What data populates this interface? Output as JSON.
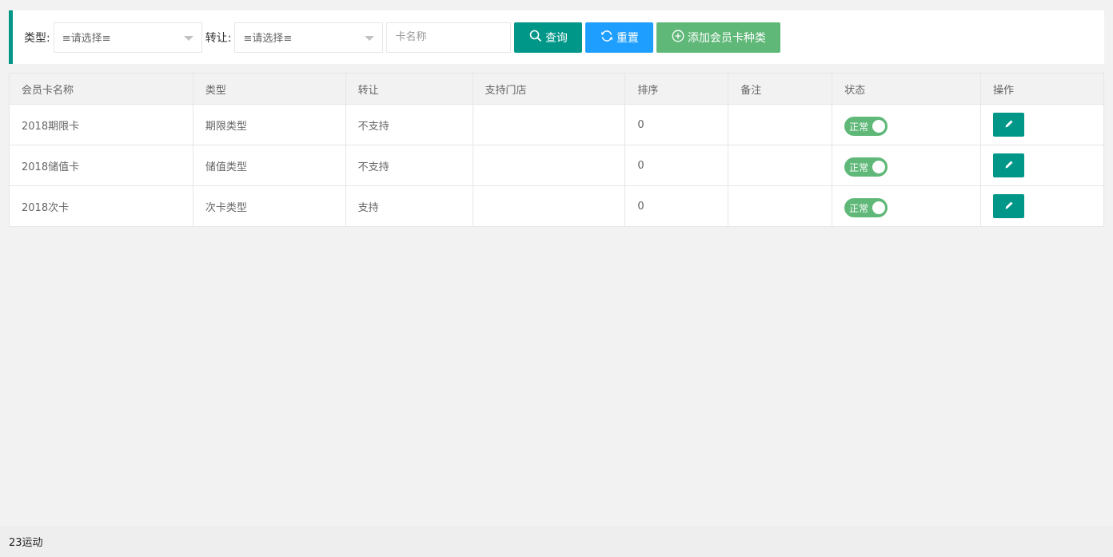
{
  "filters": {
    "type_label": "类型:",
    "type_value": "≡请选择≡",
    "transfer_label": "转让:",
    "transfer_value": "≡请选择≡",
    "name_placeholder": "卡名称",
    "query_label": "查询",
    "reset_label": "重置",
    "add_label": "添加会员卡种类"
  },
  "table": {
    "headers": [
      "会员卡名称",
      "类型",
      "转让",
      "支持门店",
      "排序",
      "备注",
      "状态",
      "操作"
    ],
    "rows": [
      {
        "name": "2018期限卡",
        "type": "期限类型",
        "transfer": "不支持",
        "stores": "",
        "sort": "0",
        "remark": "",
        "status": "正常"
      },
      {
        "name": "2018储值卡",
        "type": "储值类型",
        "transfer": "不支持",
        "stores": "",
        "sort": "0",
        "remark": "",
        "status": "正常"
      },
      {
        "name": "2018次卡",
        "type": "次卡类型",
        "transfer": "支持",
        "stores": "",
        "sort": "0",
        "remark": "",
        "status": "正常"
      }
    ]
  },
  "footer": {
    "text": "23运动"
  },
  "colors": {
    "primary": "#009688",
    "blue": "#1e9fff",
    "green": "#5fb878"
  }
}
